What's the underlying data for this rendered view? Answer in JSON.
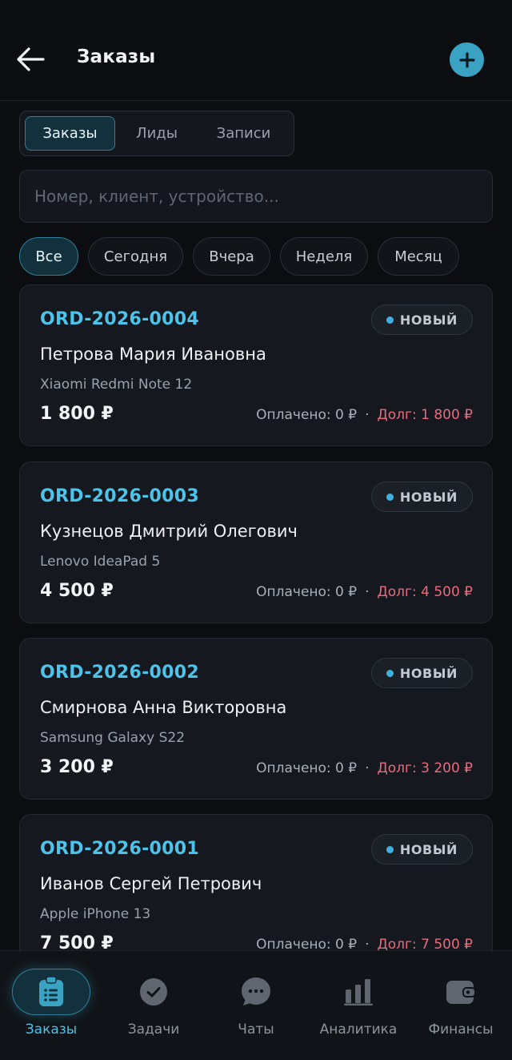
{
  "header": {
    "title": "Заказы",
    "back_icon": "arrow-left-icon",
    "add_icon": "plus-icon"
  },
  "tabs": [
    {
      "label": "Заказы",
      "active": true
    },
    {
      "label": "Лиды",
      "active": false
    },
    {
      "label": "Записи",
      "active": false
    }
  ],
  "search": {
    "placeholder": "Номер, клиент, устройство...",
    "value": ""
  },
  "filters": [
    {
      "label": "Все",
      "active": true
    },
    {
      "label": "Сегодня",
      "active": false
    },
    {
      "label": "Вчера",
      "active": false
    },
    {
      "label": "Неделя",
      "active": false
    },
    {
      "label": "Месяц",
      "active": false
    }
  ],
  "orders": [
    {
      "id": "ORD-2026-0004",
      "status": "НОВЫЙ",
      "client": "Петрова Мария Ивановна",
      "device": "Xiaomi Redmi Note 12",
      "amount": "1 800 ₽",
      "paid": "Оплачено: 0 ₽",
      "separator": "·",
      "debt": "Долг: 1 800 ₽"
    },
    {
      "id": "ORD-2026-0003",
      "status": "НОВЫЙ",
      "client": "Кузнецов Дмитрий Олегович",
      "device": "Lenovo IdeaPad 5",
      "amount": "4 500 ₽",
      "paid": "Оплачено: 0 ₽",
      "separator": "·",
      "debt": "Долг: 4 500 ₽"
    },
    {
      "id": "ORD-2026-0002",
      "status": "НОВЫЙ",
      "client": "Смирнова Анна Викторовна",
      "device": "Samsung Galaxy S22",
      "amount": "3 200 ₽",
      "paid": "Оплачено: 0 ₽",
      "separator": "·",
      "debt": "Долг: 3 200 ₽"
    },
    {
      "id": "ORD-2026-0001",
      "status": "НОВЫЙ",
      "client": "Иванов Сергей Петрович",
      "device": "Apple iPhone 13",
      "amount": "7 500 ₽",
      "paid": "Оплачено: 0 ₽",
      "separator": "·",
      "debt": "Долг: 7 500 ₽"
    }
  ],
  "bottom_nav": [
    {
      "label": "Заказы",
      "icon": "clipboard-list-icon",
      "active": true
    },
    {
      "label": "Задачи",
      "icon": "check-circle-icon",
      "active": false
    },
    {
      "label": "Чаты",
      "icon": "chat-bubble-icon",
      "active": false
    },
    {
      "label": "Аналитика",
      "icon": "bar-chart-icon",
      "active": false
    },
    {
      "label": "Финансы",
      "icon": "wallet-icon",
      "active": false
    }
  ],
  "colors": {
    "accent": "#3aa3c4",
    "order_id": "#4cc3ea",
    "debt": "#ea6b7c",
    "status_dot": "#3fb0e0",
    "background": "#0b0d11"
  }
}
